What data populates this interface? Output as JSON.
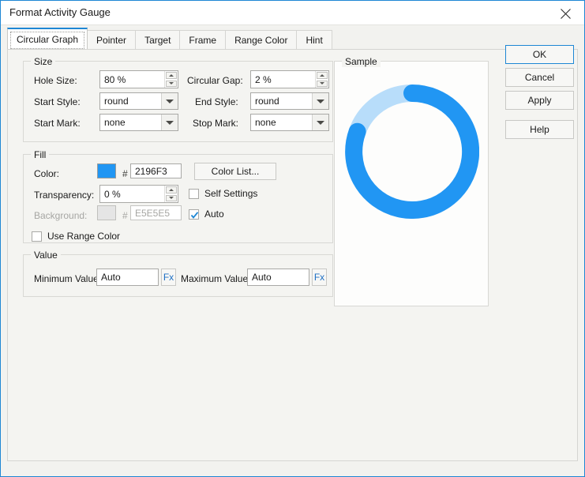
{
  "window": {
    "title": "Format Activity Gauge",
    "close_icon": "close-icon"
  },
  "tabs": [
    {
      "label": "Circular Graph",
      "active": true
    },
    {
      "label": "Pointer",
      "active": false
    },
    {
      "label": "Target",
      "active": false
    },
    {
      "label": "Frame",
      "active": false
    },
    {
      "label": "Range Color",
      "active": false
    },
    {
      "label": "Hint",
      "active": false
    }
  ],
  "size_group": {
    "title": "Size",
    "hole_size": {
      "label": "Hole Size:",
      "value": "80 %"
    },
    "circular_gap": {
      "label": "Circular Gap:",
      "value": "2 %"
    },
    "start_style": {
      "label": "Start Style:",
      "value": "round"
    },
    "end_style": {
      "label": "End Style:",
      "value": "round"
    },
    "start_mark": {
      "label": "Start Mark:",
      "value": "none"
    },
    "stop_mark": {
      "label": "Stop Mark:",
      "value": "none"
    }
  },
  "fill_group": {
    "title": "Fill",
    "color": {
      "label": "Color:",
      "hash": "#",
      "value": "2196F3",
      "swatch": "2196F3"
    },
    "color_list_button": "Color List...",
    "transparency": {
      "label": "Transparency:",
      "value": "0 %"
    },
    "self_settings": {
      "label": "Self Settings",
      "checked": false
    },
    "background": {
      "label": "Background:",
      "hash": "#",
      "value": "E5E5E5",
      "swatch": "E5E5E5",
      "disabled": true
    },
    "auto": {
      "label": "Auto",
      "checked": true
    },
    "use_range_color": {
      "label": "Use Range Color",
      "checked": false
    }
  },
  "value_group": {
    "title": "Value",
    "minimum": {
      "label": "Minimum Value:",
      "value": "Auto",
      "fx": "Fx"
    },
    "maximum": {
      "label": "Maximum Value:",
      "value": "Auto",
      "fx": "Fx"
    }
  },
  "sample": {
    "title": "Sample",
    "gauge": {
      "fill_color": "2196F3",
      "track_color": "B8DDFA",
      "hole_size": "80 %",
      "start_style": "round",
      "end_style": "round"
    }
  },
  "buttons": {
    "ok": "OK",
    "cancel": "Cancel",
    "apply": "Apply",
    "help": "Help"
  }
}
